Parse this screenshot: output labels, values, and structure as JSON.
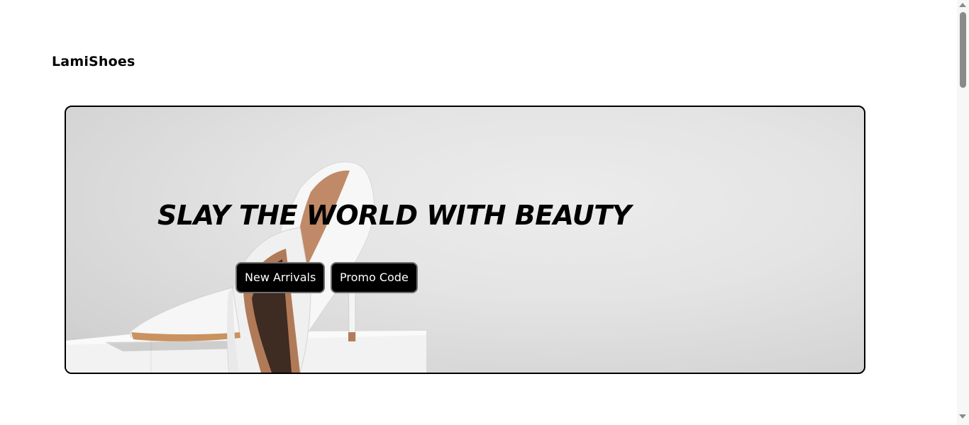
{
  "header": {
    "brand": "LamiShoes"
  },
  "hero": {
    "title": "SLAY THE WORLD WITH BEAUTY",
    "image": "white-stiletto-heels-on-pedestal",
    "buttons": {
      "new_arrivals": "New Arrivals",
      "promo_code": "Promo Code"
    }
  },
  "colors": {
    "accent": "#000000",
    "button_text": "#ffffff",
    "background": "#ffffff"
  }
}
